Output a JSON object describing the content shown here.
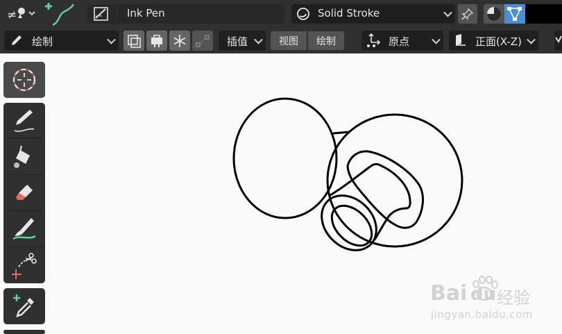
{
  "header": {
    "material_name": "Ink Pen",
    "stroke_type": "Solid Stroke"
  },
  "toolbar": {
    "mode": "绘制",
    "interpolate": "插值",
    "tab_view": "视图",
    "tab_draw": "绘制",
    "origin": "原点",
    "view_axis": "正面(X-Z)"
  },
  "tools": {
    "cursor": "cursor-icon",
    "draw": "pencil-icon",
    "fill": "bucket-fill-icon",
    "erase": "eraser-icon",
    "tint": "tint-brush-icon",
    "cutter": "cutter-icon",
    "eyedropper": "eyedropper-icon"
  },
  "watermark": {
    "brand_left": "Bai",
    "brand_right": "经验",
    "url": "jingyan.baidu.com"
  },
  "colors": {
    "header_bg": "#303030",
    "canvas_bg": "#fafafa",
    "accent_blue": "#4a8fd6",
    "stroke_green": "#5fd39a",
    "eraser_red": "#e06b5c"
  }
}
